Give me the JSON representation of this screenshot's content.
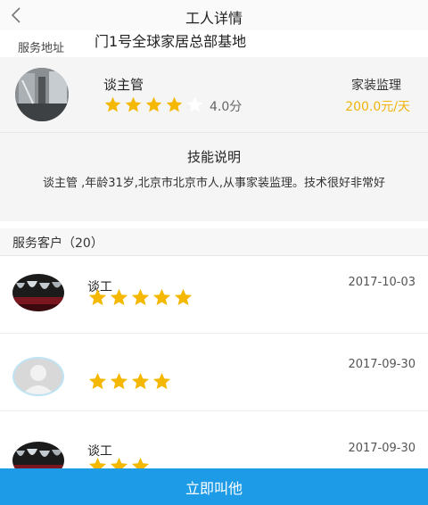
{
  "header": {
    "title": "工人详情"
  },
  "address": {
    "label": "服务地址",
    "value": "门1号全球家居总部基地"
  },
  "worker": {
    "name": "谈主管",
    "rating": 4.0,
    "score_text": "4.0分",
    "role": "家装监理",
    "price": "200.0元/天"
  },
  "skills": {
    "title": "技能说明",
    "text": "谈主管 ,年龄31岁,北京市北京市人,从事家装监理。技术很好非常好"
  },
  "customers": {
    "title": "服务客户（20）",
    "reviews": [
      {
        "name": "谈工",
        "stars": 5,
        "date": "2017-10-03",
        "avatar": "wine-glasses-photo"
      },
      {
        "name": "",
        "stars": 4,
        "date": "2017-09-30",
        "avatar": "default-user-icon"
      },
      {
        "name": "谈工",
        "stars": 3,
        "date": "2017-09-30",
        "avatar": "wine-glasses-photo"
      }
    ]
  },
  "footer": {
    "call_label": "立即叫他"
  },
  "colors": {
    "star": "#f5b800",
    "price": "#f0b40a",
    "primary": "#1e9be6"
  },
  "icons": {
    "back": "chevron-left-icon",
    "star": "star-icon"
  }
}
